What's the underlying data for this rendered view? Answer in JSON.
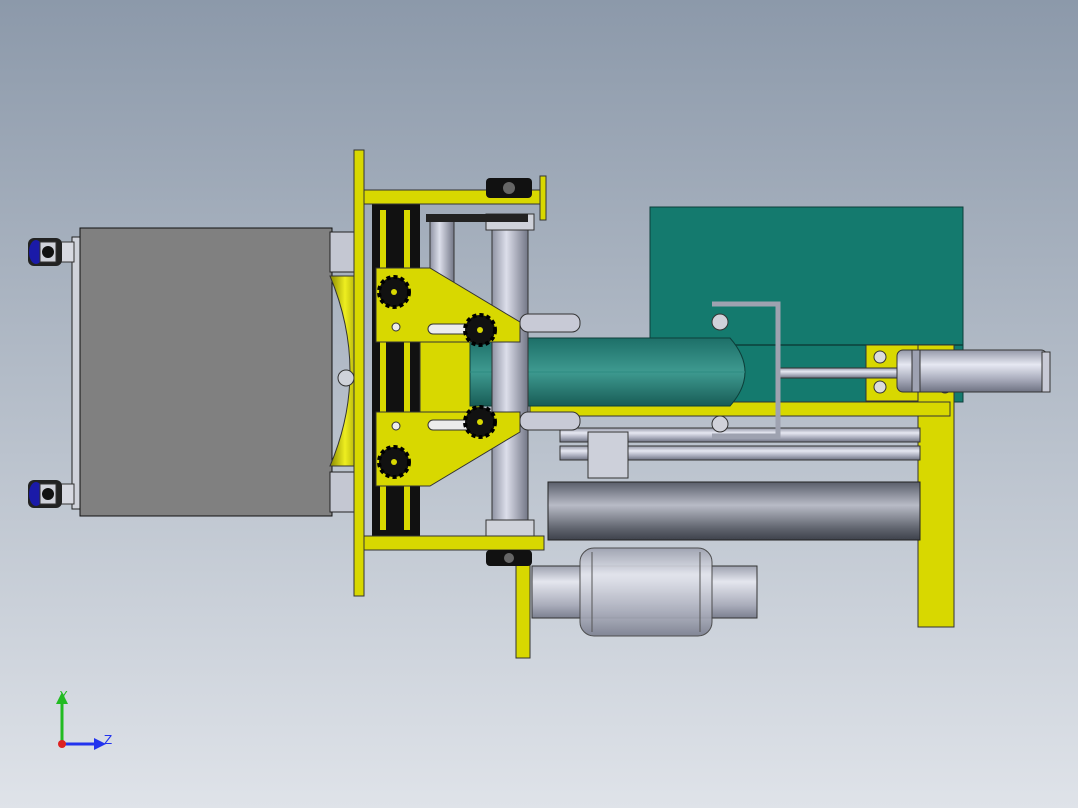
{
  "colors": {
    "background_top": "#8c99aa",
    "background_bottom": "#dfe3e9",
    "yellow": "#d8d800",
    "teal": "#147a6e",
    "gray_box": "#808080",
    "steel": "#b9bccb",
    "axis_y": "#22bb22",
    "axis_z": "#2233ee",
    "axis_x": "#dd2222"
  },
  "axis_triad": {
    "y_label": "Y",
    "z_label": "Z"
  }
}
